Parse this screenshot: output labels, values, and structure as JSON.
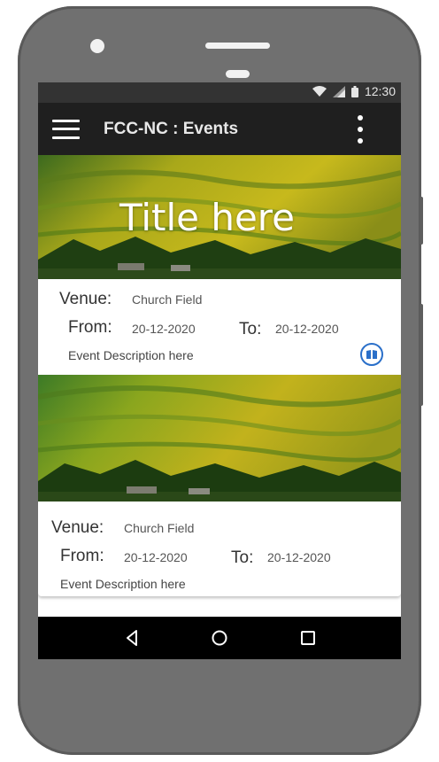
{
  "status_bar": {
    "time": "12:30"
  },
  "app_bar": {
    "title": "FCC-NC : Events",
    "menu_icon": "hamburger-menu-icon",
    "overflow_icon": "more-vert-icon"
  },
  "events": [
    {
      "title": "Title here",
      "venue_label": "Venue:",
      "venue": "Church Field",
      "from_label": "From:",
      "from": "20-12-2020",
      "to_label": "To:",
      "to": "20-12-2020",
      "description": "Event Description here"
    },
    {
      "title": "",
      "venue_label": "Venue:",
      "venue": "Church Field",
      "from_label": "From:",
      "from": "20-12-2020",
      "to_label": "To:",
      "to": "20-12-2020",
      "description": "Event Description here"
    }
  ],
  "fab": {
    "label": "+",
    "icon": "add-icon"
  },
  "colors": {
    "app_bar": "#1f1f1f",
    "status_bar": "#333333",
    "fab": "#1ab3d6",
    "book_icon": "#2a6fc9"
  }
}
